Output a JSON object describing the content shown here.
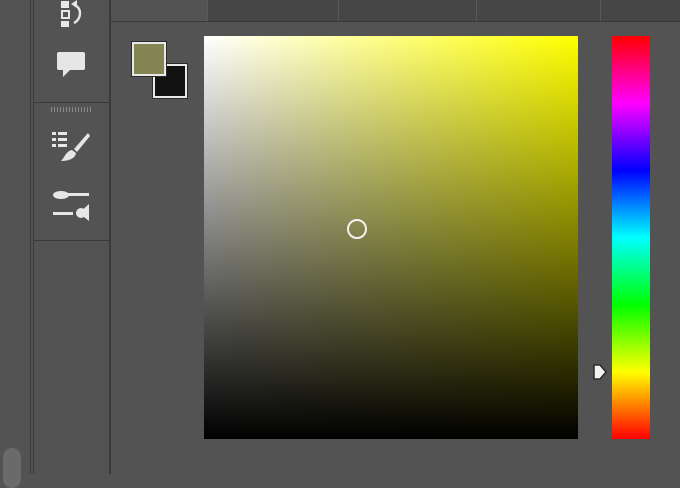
{
  "colors": {
    "foreground": "#858554",
    "background": "#111111",
    "panel": "#535353"
  },
  "icons": {
    "tool_1": "transform-history-icon",
    "tool_2": "comment-icon",
    "tool_3": "brush-list-icon",
    "tool_4": "brush-settings-icon"
  },
  "color_picker": {
    "hue_deg": 60,
    "saturation": 0.41,
    "brightness": 0.52
  }
}
